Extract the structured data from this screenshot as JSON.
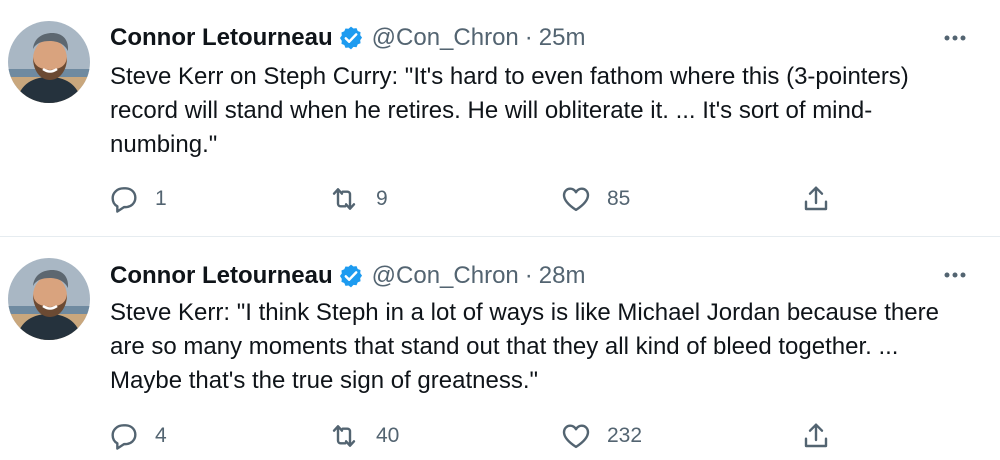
{
  "tweets": [
    {
      "author": {
        "name": "Connor Letourneau",
        "handle": "@Con_Chron",
        "verified": true
      },
      "separator": "·",
      "time": "25m",
      "text": "Steve Kerr on Steph Curry: \"It's hard to even fathom where this (3-pointers) record will stand when he retires. He will obliterate it. ... It's sort of mind-numbing.\"",
      "stats": {
        "replies": "1",
        "retweets": "9",
        "likes": "85"
      }
    },
    {
      "author": {
        "name": "Connor Letourneau",
        "handle": "@Con_Chron",
        "verified": true
      },
      "separator": "·",
      "time": "28m",
      "text": "Steve Kerr: \"I think Steph in a lot of ways is like Michael Jordan because there are so many moments that stand out that they all kind of bleed together. ... Maybe that's the true sign of greatness.\"",
      "stats": {
        "replies": "4",
        "retweets": "40",
        "likes": "232"
      }
    }
  ],
  "icons": {
    "verified": "verified-badge-icon",
    "more": "more-horizontal-icon",
    "reply": "reply-icon",
    "retweet": "retweet-icon",
    "like": "heart-icon",
    "share": "share-icon"
  },
  "colors": {
    "verified_blue": "#1d9bf0",
    "text_primary": "#0f1419",
    "text_secondary": "#536471",
    "divider": "#e6ecf0"
  }
}
